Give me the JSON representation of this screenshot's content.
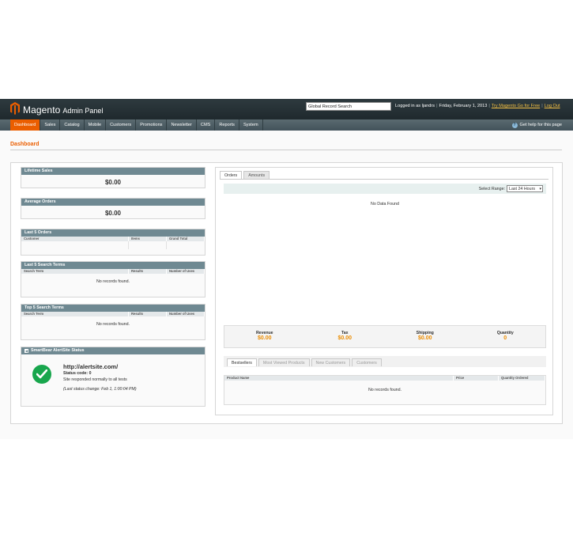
{
  "header": {
    "logo": "Magento",
    "logo_sub": "Admin Panel",
    "search_value": "Global Record Search",
    "logged_in": "Logged in as ljandrs",
    "date": "Friday, February 1, 2013",
    "try_link": "Try Magento Go for Free",
    "logout": "Log Out"
  },
  "nav": {
    "items": [
      "Dashboard",
      "Sales",
      "Catalog",
      "Mobile",
      "Customers",
      "Promotions",
      "Newsletter",
      "CMS",
      "Reports",
      "System"
    ],
    "help": "Get help for this page"
  },
  "page": {
    "title": "Dashboard"
  },
  "lifetime_sales": {
    "title": "Lifetime Sales",
    "value": "$0.00"
  },
  "average_orders": {
    "title": "Average Orders",
    "value": "$0.00"
  },
  "last_orders": {
    "title": "Last 5 Orders",
    "columns": [
      "Customer",
      "Items",
      "Grand Total"
    ]
  },
  "last_search": {
    "title": "Last 5 Search Terms",
    "columns": [
      "Search Term",
      "Results",
      "Number of Uses"
    ],
    "empty": "No records found."
  },
  "top_search": {
    "title": "Top 5 Search Terms",
    "columns": [
      "Search Term",
      "Results",
      "Number of Uses"
    ],
    "empty": "No records found."
  },
  "alertsite": {
    "title": "SmartBear AlertSite Status",
    "url": "http://alertsite.com/",
    "status_label": "Status code:",
    "status_code": "0",
    "message": "Site responded normally to all tests",
    "last_change": "(Last status change: Feb 1, 1:00:04 PM)"
  },
  "chart_tabs": [
    "Orders",
    "Amounts"
  ],
  "range": {
    "label": "Select Range:",
    "value": "Last 24 Hours"
  },
  "no_data": "No Data Found",
  "totals": [
    {
      "label": "Revenue",
      "value": "$0.00"
    },
    {
      "label": "Tax",
      "value": "$0.00"
    },
    {
      "label": "Shipping",
      "value": "$0.00"
    },
    {
      "label": "Quantity",
      "value": "0"
    }
  ],
  "bottom_tabs": [
    "Bestsellers",
    "Most Viewed Products",
    "New Customers",
    "Customers"
  ],
  "bestsellers": {
    "columns": [
      "Product Name",
      "Price",
      "Quantity Ordered"
    ],
    "empty": "No records found."
  },
  "colors": {
    "accent": "#eb5e00",
    "header": "#1f292d",
    "box_head": "#6f8992",
    "total": "#eb8c00",
    "success": "#18a64d"
  }
}
